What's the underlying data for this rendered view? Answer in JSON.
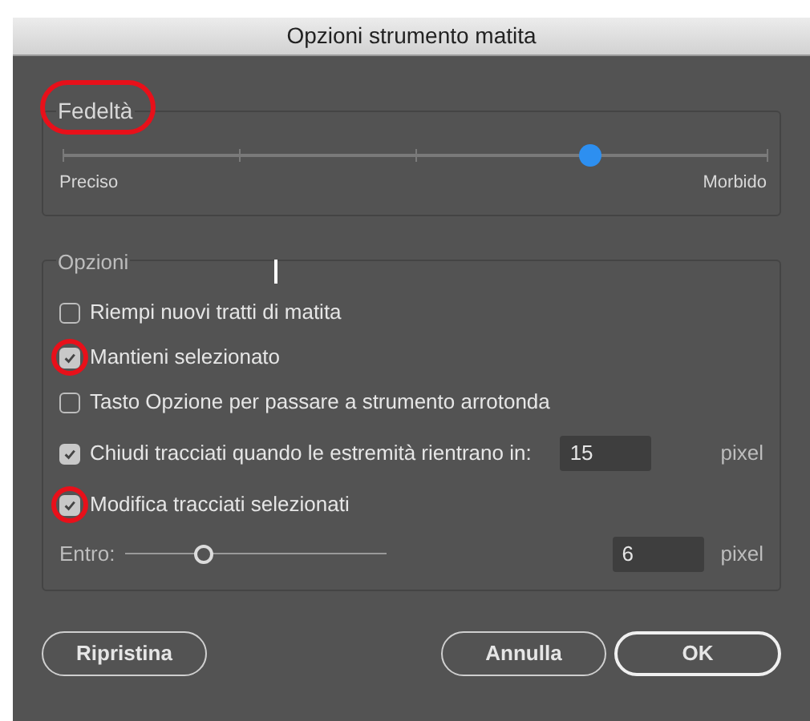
{
  "window": {
    "title": "Opzioni strumento matita"
  },
  "fidelity": {
    "legend": "Fedeltà",
    "highlighted": true,
    "level": 0.75,
    "min_label": "Preciso",
    "max_label": "Morbido"
  },
  "options": {
    "legend": "Opzioni",
    "items": [
      {
        "kind": "checkbox",
        "label": "Riempi nuovi tratti di matita",
        "checked": false,
        "highlighted": false
      },
      {
        "kind": "checkbox",
        "label": "Mantieni selezionato",
        "checked": true,
        "highlighted": true
      },
      {
        "kind": "checkbox",
        "label": "Tasto Opzione per passare a strumento arrotonda",
        "checked": false,
        "highlighted": false
      },
      {
        "kind": "checkbox",
        "label": "Chiudi tracciati quando le estremità rientrano in:",
        "checked": true,
        "highlighted": false,
        "value": "15",
        "unit": "pixel"
      },
      {
        "kind": "checkbox",
        "label": "Modifica tracciati selezionati",
        "checked": true,
        "highlighted": true
      },
      {
        "kind": "slider",
        "label": "Entro:",
        "level": 0.3,
        "value": "6",
        "unit": "pixel"
      }
    ]
  },
  "buttons": [
    {
      "label": "Ripristina",
      "default": false
    },
    {
      "label": "Annulla",
      "default": false
    },
    {
      "label": "OK",
      "default": true
    }
  ]
}
